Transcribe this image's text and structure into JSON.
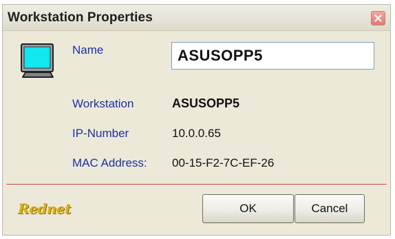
{
  "window": {
    "title": "Workstation Properties"
  },
  "icons": {
    "monitor": "monitor-icon",
    "close": "close-icon"
  },
  "colors": {
    "label": "#1d2fa8",
    "separator": "#c63d3d",
    "monitor_screen": "#12e6ee",
    "close_button": "#e0857c",
    "logo": "#d8b21a"
  },
  "form": {
    "name_label": "Name",
    "name_value": "ASUSOPP5",
    "workstation_label": "Workstation",
    "workstation_value": "ASUSOPP5",
    "ip_label": "IP-Number",
    "ip_value": "10.0.0.65",
    "mac_label": "MAC Address:",
    "mac_value": "00-15-F2-7C-EF-26"
  },
  "footer": {
    "logo_text": "Rednet",
    "ok_label": "OK",
    "cancel_label": "Cancel"
  }
}
